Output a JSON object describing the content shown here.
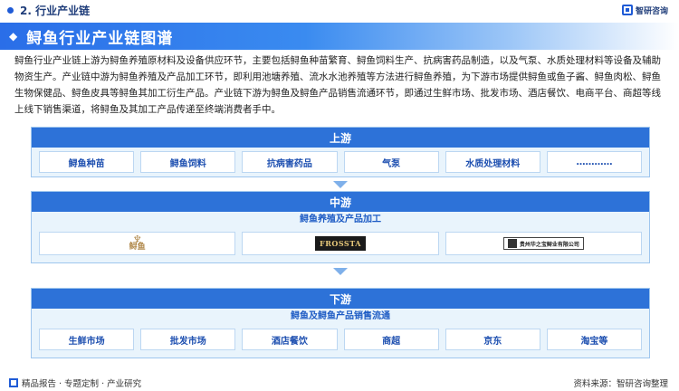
{
  "topbar": {
    "section": "2. 行业产业链",
    "brand": "智研咨询"
  },
  "title": "鲟鱼行业产业链图谱",
  "description": "鲟鱼行业产业链上游为鲟鱼养殖原材料及设备供应环节，主要包括鲟鱼种苗繁育、鲟鱼饲料生产、抗病害药品制造，以及气泵、水质处理材料等设备及辅助物资生产。产业链中游为鲟鱼养殖及产品加工环节，即利用池塘养殖、流水水池养殖等方法进行鲟鱼养殖，为下游市场提供鲟鱼或鱼子酱、鲟鱼肉松、鲟鱼生物保健品、鲟鱼皮具等鲟鱼其加工衍生产品。产业链下游为鲟鱼及鲟鱼产品销售流通环节，即通过生鲜市场、批发市场、酒店餐饮、电商平台、商超等线上线下销售渠道，将鲟鱼及其加工产品传递至终端消费者手中。",
  "upstream": {
    "header": "上游",
    "items": [
      "鲟鱼种苗",
      "鲟鱼饲料",
      "抗病害药品",
      "气泵",
      "水质处理材料",
      "…………"
    ]
  },
  "midstream": {
    "header": "中游",
    "subtitle": "鲟鱼养殖及产品加工",
    "logos": [
      {
        "name": "logo-1",
        "text": "鲟鱼"
      },
      {
        "name": "logo-2",
        "text": "FROSSTA"
      },
      {
        "name": "logo-3",
        "text": "贵州华之宝鲟业有限公司"
      }
    ]
  },
  "downstream": {
    "header": "下游",
    "subtitle": "鲟鱼及鲟鱼产品销售流通",
    "items": [
      "生鲜市场",
      "批发市场",
      "酒店餐饮",
      "商超",
      "京东",
      "淘宝等"
    ]
  },
  "footer": {
    "left": "精品报告 · 专题定制 · 产业研究",
    "right": "资料来源：智研咨询整理"
  },
  "colors": {
    "primary": "#2d72d8",
    "tier_bg": "#e9f4fc",
    "text_accent": "#1d4fb0"
  }
}
